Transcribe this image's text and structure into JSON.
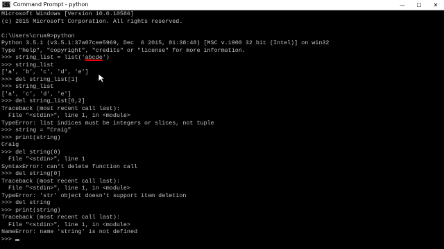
{
  "window": {
    "title": "Command Prompt - python",
    "controls": {
      "minimize": "—",
      "maximize": "☐",
      "close": "✕"
    }
  },
  "console": {
    "lines": [
      "Microsoft Windows [Version 10.0.10586]",
      "(c) 2015 Microsoft Corporation. All rights reserved.",
      "",
      "C:\\Users\\crua9>python",
      "Python 3.5.1 (v3.5.1:37a07cee5969, Dec  6 2015, 01:38:48) [MSC v.1900 32 bit (Intel)] on win32",
      "Type \"help\", \"copyright\", \"credits\" or \"license\" for more information.",
      ">>> string_list = list('abcde')",
      ">>> string_list",
      "['a', 'b', 'c', 'd', 'e']",
      ">>> del string_list[1]",
      ">>> string_list",
      "['a', 'c', 'd', 'e']",
      ">>> del string_list[0,2]",
      "Traceback (most recent call last):",
      "  File \"<stdin>\", line 1, in <module>",
      "TypeError: list indices must be integers or slices, not tuple",
      ">>> string = \"Craig\"",
      ">>> print(string)",
      "Craig",
      ">>> del string(0)",
      "  File \"<stdin>\", line 1",
      "SyntaxError: can't delete function call",
      ">>> del string[0]",
      "Traceback (most recent call last):",
      "  File \"<stdin>\", line 1, in <module>",
      "TypeError: 'str' object doesn't support item deletion",
      ">>> del string",
      ">>> print(string)",
      "Traceback (most recent call last):",
      "  File \"<stdin>\", line 1, in <module>",
      "NameError: name 'string' is not defined",
      ">>> "
    ],
    "highlight": {
      "line_index": 6,
      "text": "abcde",
      "color": "#e60000"
    },
    "text_color": "#c0c0c0",
    "background_color": "#000000"
  },
  "icons": {
    "window_icon": "command-prompt-icon",
    "pointer": "mouse-pointer-icon"
  }
}
